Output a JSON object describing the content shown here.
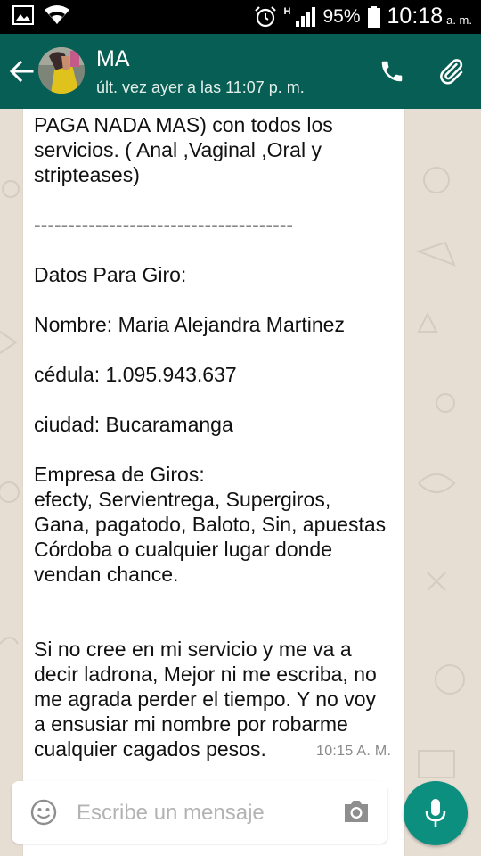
{
  "status_bar": {
    "network": "H",
    "battery": "95%",
    "time": "10:18",
    "ampm": "a. m."
  },
  "header": {
    "contact_name": "MA",
    "last_seen": "últ. vez ayer a las 11:07 p. m."
  },
  "message": {
    "lines": [
      "PAGA NADA MAS) con todos los",
      "servicios. ( Anal ,Vaginal ,Oral y",
      "stripteases)",
      "",
      "--------------------------------------",
      "",
      "Datos Para Giro:",
      "",
      "Nombre: Maria Alejandra Martinez",
      "",
      "cédula: 1.095.943.637",
      "",
      "ciudad: Bucaramanga",
      "",
      "Empresa de Giros:",
      "efecty, Servientrega, Supergiros,",
      "Gana, pagatodo, Baloto, Sin, apuestas",
      "Córdoba o cualquier lugar donde",
      "vendan chance.",
      "",
      "",
      "Si no cree en mi servicio y me va a",
      "decir ladrona, Mejor ni me escriba, no",
      "me agrada perder el tiempo. Y no voy",
      "a ensusiar mi nombre por robarme",
      "cualquier cagados pesos."
    ],
    "time": "10:15 A. M."
  },
  "composer": {
    "placeholder": "Escribe un mensaje",
    "value": ""
  },
  "colors": {
    "appbar": "#075e54",
    "mic_button": "#0c8f7e",
    "chat_bg": "#e6ddd3"
  },
  "icons": [
    "gallery-icon",
    "wifi-icon",
    "alarm-icon",
    "signal-icon",
    "battery-icon",
    "back-arrow-icon",
    "phone-icon",
    "paperclip-icon",
    "emoji-icon",
    "camera-icon",
    "mic-icon"
  ]
}
